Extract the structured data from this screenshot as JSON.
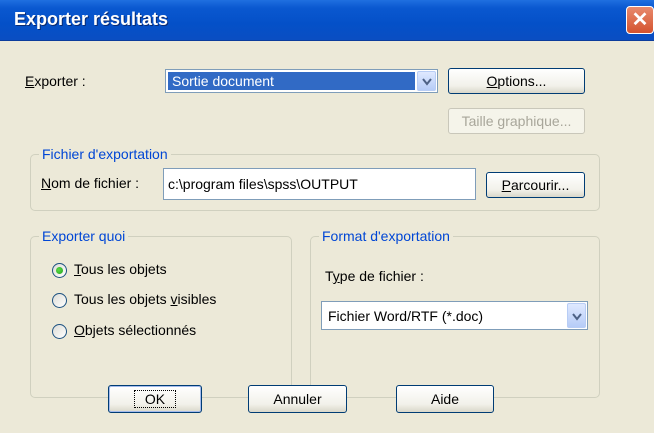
{
  "window": {
    "title": "Exporter résultats",
    "close_icon": "close-icon"
  },
  "export": {
    "label_prefix": "",
    "label_mnemonic": "E",
    "label_rest": "xporter :",
    "selected": "Sortie document"
  },
  "buttons": {
    "options": {
      "mnemonic": "O",
      "rest": "ptions..."
    },
    "taille": "Taille graphique...",
    "parcourir": {
      "mnemonic": "P",
      "rest": "arcourir..."
    },
    "ok": "OK",
    "annuler": "Annuler",
    "aide": "Aide"
  },
  "fichier": {
    "legend": "Fichier d'exportation",
    "nom_mnemonic": "N",
    "nom_rest": "om de fichier :",
    "value": "c:\\program files\\spss\\OUTPUT"
  },
  "quoi": {
    "legend": "Exporter quoi",
    "options": [
      {
        "mnemonic": "T",
        "rest": "ous les objets",
        "checked": true
      },
      {
        "before": "Tous les objets ",
        "mnemonic": "v",
        "rest": "isibles",
        "checked": false
      },
      {
        "mnemonic": "O",
        "rest": "bjets sélectionnés",
        "checked": false
      }
    ]
  },
  "format": {
    "legend": "Format d'exportation",
    "type_label_before": "T",
    "type_mnemonic": "y",
    "type_label_rest": "pe de fichier :",
    "selected": "Fichier Word/RTF (*.doc)"
  },
  "colors": {
    "titlebar": "#0450c8",
    "dialog_bg": "#ece9d8",
    "selection": "#316ac5",
    "group_legend": "#0046d5"
  }
}
